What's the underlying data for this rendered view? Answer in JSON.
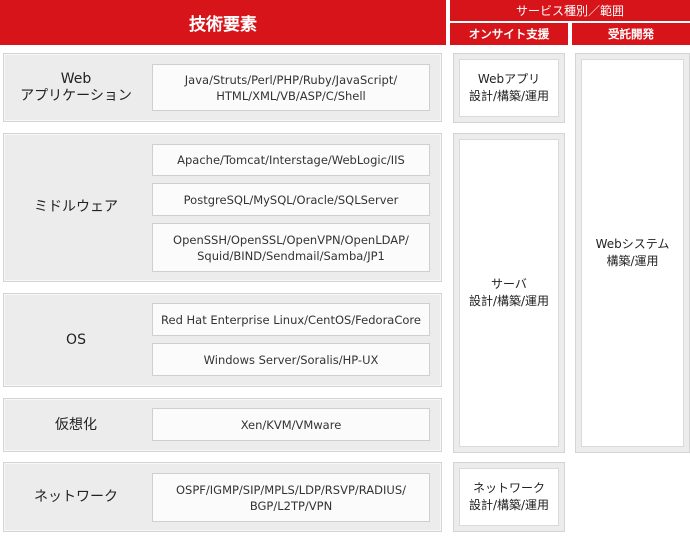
{
  "header": {
    "main": "技術要素",
    "scope": "サービス種別／範囲",
    "onsite": "オンサイト支援",
    "dev": "受託開発"
  },
  "rows": {
    "web": {
      "label": "Web\nアプリケーション",
      "techs": [
        "Java/Struts/Perl/PHP/Ruby/JavaScript/\nHTML/XML/VB/ASP/C/Shell"
      ]
    },
    "middleware": {
      "label": "ミドルウェア",
      "techs": [
        "Apache/Tomcat/Interstage/WebLogic/IIS",
        "PostgreSQL/MySQL/Oracle/SQLServer",
        "OpenSSH/OpenSSL/OpenVPN/OpenLDAP/\nSquid/BIND/Sendmail/Samba/JP1"
      ]
    },
    "os": {
      "label": "OS",
      "techs": [
        "Red Hat Enterprise Linux/CentOS/FedoraCore",
        "Windows Server/Soralis/HP-UX"
      ]
    },
    "virtual": {
      "label": "仮想化",
      "techs": [
        "Xen/KVM/VMware"
      ]
    },
    "network": {
      "label": "ネットワーク",
      "techs": [
        "OSPF/IGMP/SIP/MPLS/LDP/RSVP/RADIUS/\nBGP/L2TP/VPN"
      ]
    }
  },
  "services": {
    "web_app": "Webアプリ\n設計/構築/運用",
    "server": "サーバ\n設計/構築/運用",
    "network": "ネットワーク\n設計/構築/運用",
    "web_system": "Webシステム\n構築/運用"
  }
}
